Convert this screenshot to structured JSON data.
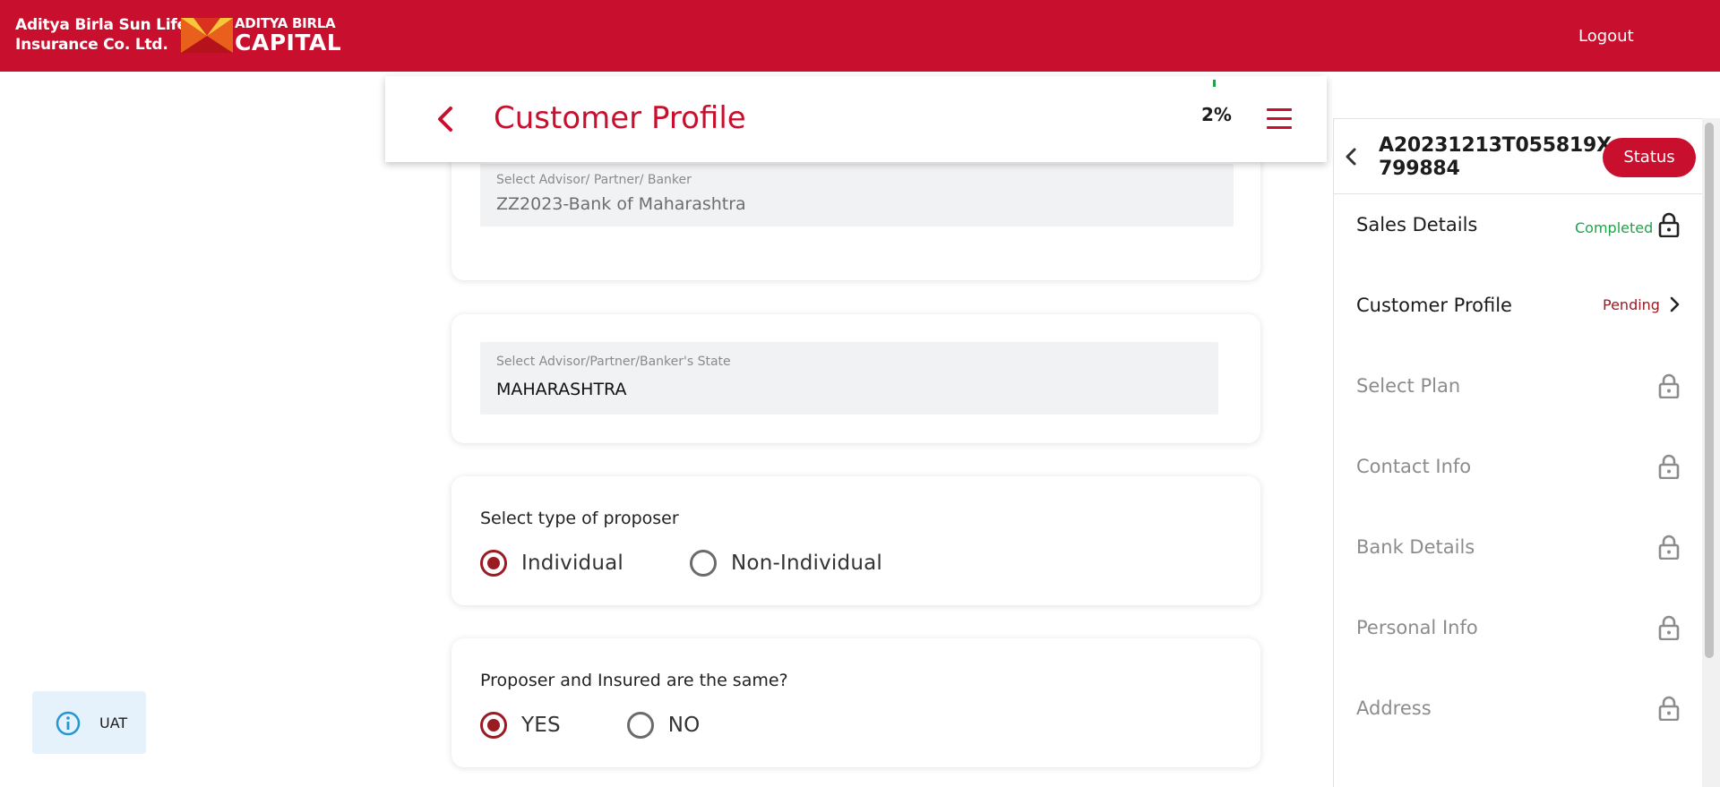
{
  "header": {
    "company_line1": "Aditya Birla Sun Life",
    "company_line2": "Insurance Co. Ltd.",
    "logo_line1": "ADITYA BIRLA",
    "logo_line2": "CAPITAL",
    "logout_label": "Logout",
    "brand_color": "#c8102e"
  },
  "page": {
    "title": "Customer Profile",
    "progress": "2%",
    "back_icon": "chevron-left-icon",
    "menu_icon": "hamburger-menu-icon"
  },
  "form": {
    "advisor": {
      "label": "Select Advisor/ Partner/ Banker",
      "value": "ZZ2023-Bank of Maharashtra"
    },
    "advisor_state": {
      "label": "Select Advisor/Partner/Banker's State",
      "value": "MAHARASHTRA"
    },
    "proposer_type": {
      "question": "Select type of proposer",
      "options": [
        "Individual",
        "Non-Individual"
      ],
      "selected": "Individual"
    },
    "same_insured": {
      "question": "Proposer and Insured are the same?",
      "options": [
        "YES",
        "NO"
      ],
      "selected": "YES"
    }
  },
  "uat_badge": {
    "label": "UAT",
    "icon": "info-icon"
  },
  "sidebar": {
    "application_no_line1": "A20231213T055819X",
    "application_no_line2": "799884",
    "status_label": "Status",
    "items": [
      {
        "label": "Sales Details",
        "state": "Completed",
        "icon": "lock-icon"
      },
      {
        "label": "Customer Profile",
        "state": "Pending",
        "icon": "chevron-right-icon"
      },
      {
        "label": "Select Plan",
        "state": "",
        "icon": "lock-icon"
      },
      {
        "label": "Contact Info",
        "state": "",
        "icon": "lock-icon"
      },
      {
        "label": "Bank Details",
        "state": "",
        "icon": "lock-icon"
      },
      {
        "label": "Personal Info",
        "state": "",
        "icon": "lock-icon"
      },
      {
        "label": "Address",
        "state": "",
        "icon": "lock-icon"
      }
    ],
    "completed_color": "#1ea34a",
    "pending_color": "#9b1b22"
  }
}
